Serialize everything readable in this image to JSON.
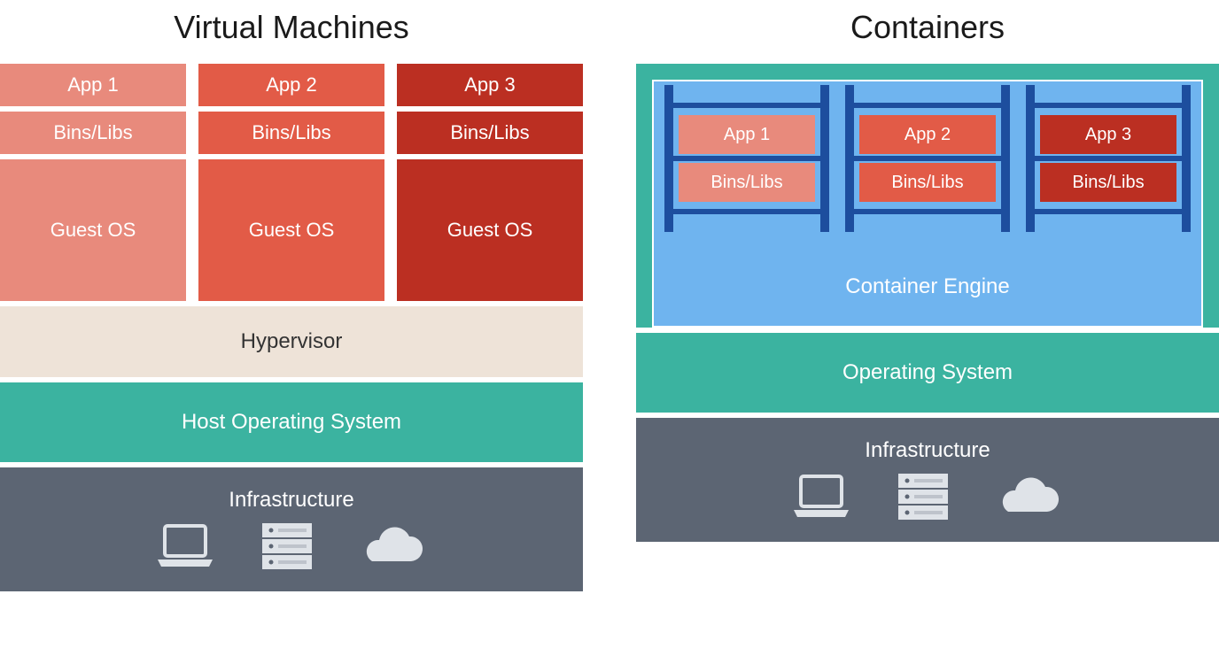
{
  "vm": {
    "title": "Virtual Machines",
    "cols": [
      {
        "app": "App 1",
        "libs": "Bins/Libs",
        "os": "Guest OS"
      },
      {
        "app": "App 2",
        "libs": "Bins/Libs",
        "os": "Guest OS"
      },
      {
        "app": "App 3",
        "libs": "Bins/Libs",
        "os": "Guest OS"
      }
    ],
    "hypervisor": "Hypervisor",
    "host_os": "Host Operating System",
    "infra": "Infrastructure"
  },
  "ct": {
    "title": "Containers",
    "shelves": [
      {
        "app": "App 1",
        "libs": "Bins/Libs"
      },
      {
        "app": "App 2",
        "libs": "Bins/Libs"
      },
      {
        "app": "App 3",
        "libs": "Bins/Libs"
      }
    ],
    "engine": "Container Engine",
    "os": "Operating System",
    "infra": "Infrastructure"
  },
  "colors": {
    "red1": "#e88a7c",
    "red2": "#e25b47",
    "red3": "#bb2f22",
    "teal": "#3bb3a0",
    "blue_light": "#6fb4ef",
    "blue_dark": "#1d4e9e",
    "slate": "#5c6573",
    "beige": "#eee3d8"
  }
}
